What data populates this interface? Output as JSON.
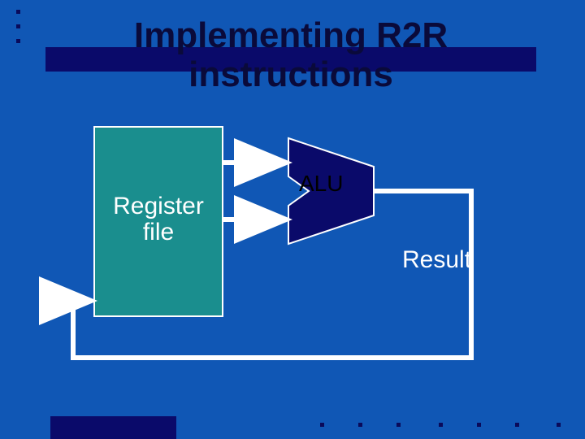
{
  "title": "Implementing R2R instructions",
  "blocks": {
    "register_file": "Register file",
    "alu": "ALU"
  },
  "labels": {
    "result": "Result"
  },
  "diagram": {
    "components": [
      {
        "name": "register-file",
        "type": "storage"
      },
      {
        "name": "alu",
        "type": "compute"
      }
    ],
    "connections": [
      {
        "from": "register-file",
        "to": "alu",
        "port": "top-input"
      },
      {
        "from": "register-file",
        "to": "alu",
        "port": "bottom-input"
      },
      {
        "from": "alu",
        "to": "register-file",
        "label": "Result",
        "feedback": true
      }
    ]
  }
}
